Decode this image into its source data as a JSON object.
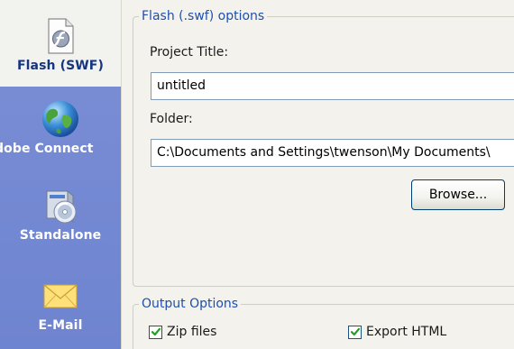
{
  "sidebar": {
    "items": [
      {
        "label": "Flash (SWF)",
        "icon": "flash-document-icon",
        "selected": true
      },
      {
        "label": "dobe Connect",
        "icon": "globe-icon",
        "selected": false
      },
      {
        "label": "Standalone",
        "icon": "cd-package-icon",
        "selected": false
      },
      {
        "label": "E-Mail",
        "icon": "envelope-icon",
        "selected": false
      }
    ],
    "colors": {
      "background": "#7b8fd6",
      "selected_background": "#f2f2ee",
      "selected_text": "#16357e"
    }
  },
  "flash_options": {
    "legend": "Flash (.swf) options",
    "project_title_label": "Project Title:",
    "project_title_value": "untitled",
    "folder_label": "Folder:",
    "folder_value": "C:\\Documents and Settings\\twenson\\My Documents\\",
    "browse_label": "Browse..."
  },
  "output_options": {
    "legend": "Output Options",
    "zip_files_label": "Zip files",
    "zip_files_checked": true,
    "export_html_label": "Export HTML",
    "export_html_checked": true
  },
  "colors": {
    "legend_text": "#1f4fae",
    "checkmark": "#21a121",
    "panel_background": "#f3f2ec"
  }
}
